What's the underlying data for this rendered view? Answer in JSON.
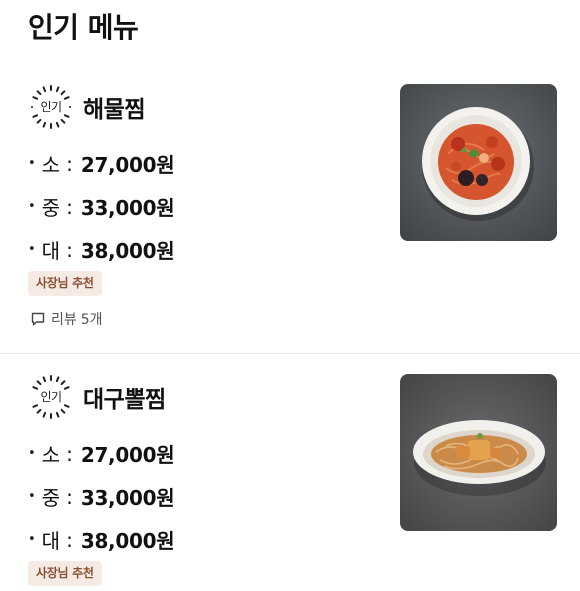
{
  "section": {
    "title": "인기 메뉴"
  },
  "menus": [
    {
      "badge": "인기",
      "name": "해물찜",
      "prices": [
        {
          "size": "소",
          "amount": "27,000원"
        },
        {
          "size": "중",
          "amount": "33,000원"
        },
        {
          "size": "대",
          "amount": "38,000원"
        }
      ],
      "tag": "사장님 추천",
      "review_label": "리뷰",
      "review_count": "5개",
      "image_icon": "seafood-stew-photo"
    },
    {
      "badge": "인기",
      "name": "대구뽈찜",
      "prices": [
        {
          "size": "소",
          "amount": "27,000원"
        },
        {
          "size": "중",
          "amount": "33,000원"
        },
        {
          "size": "대",
          "amount": "38,000원"
        }
      ],
      "tag": "사장님 추천",
      "image_icon": "braised-cod-cheek-photo"
    }
  ],
  "colors": {
    "tag_bg": "#f6ebe4",
    "tag_text": "#8a4e31",
    "divider": "#ececec"
  }
}
